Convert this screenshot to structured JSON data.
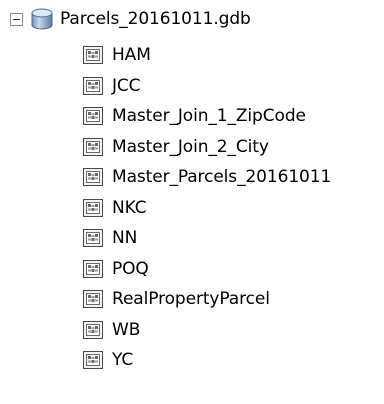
{
  "tree": {
    "root": {
      "label": "Parcels_20161011.gdb",
      "expander_icon": "collapse-minus-icon",
      "icon": "geodatabase-icon"
    },
    "children": [
      {
        "label": "HAM",
        "icon": "feature-class-icon"
      },
      {
        "label": "JCC",
        "icon": "feature-class-icon"
      },
      {
        "label": "Master_Join_1_ZipCode",
        "icon": "feature-class-icon"
      },
      {
        "label": "Master_Join_2_City",
        "icon": "feature-class-icon"
      },
      {
        "label": "Master_Parcels_20161011",
        "icon": "feature-class-icon"
      },
      {
        "label": "NKC",
        "icon": "feature-class-icon"
      },
      {
        "label": "NN",
        "icon": "feature-class-icon"
      },
      {
        "label": "POQ",
        "icon": "feature-class-icon"
      },
      {
        "label": "RealPropertyParcel",
        "icon": "feature-class-icon"
      },
      {
        "label": "WB",
        "icon": "feature-class-icon"
      },
      {
        "label": "YC",
        "icon": "feature-class-icon"
      }
    ]
  }
}
